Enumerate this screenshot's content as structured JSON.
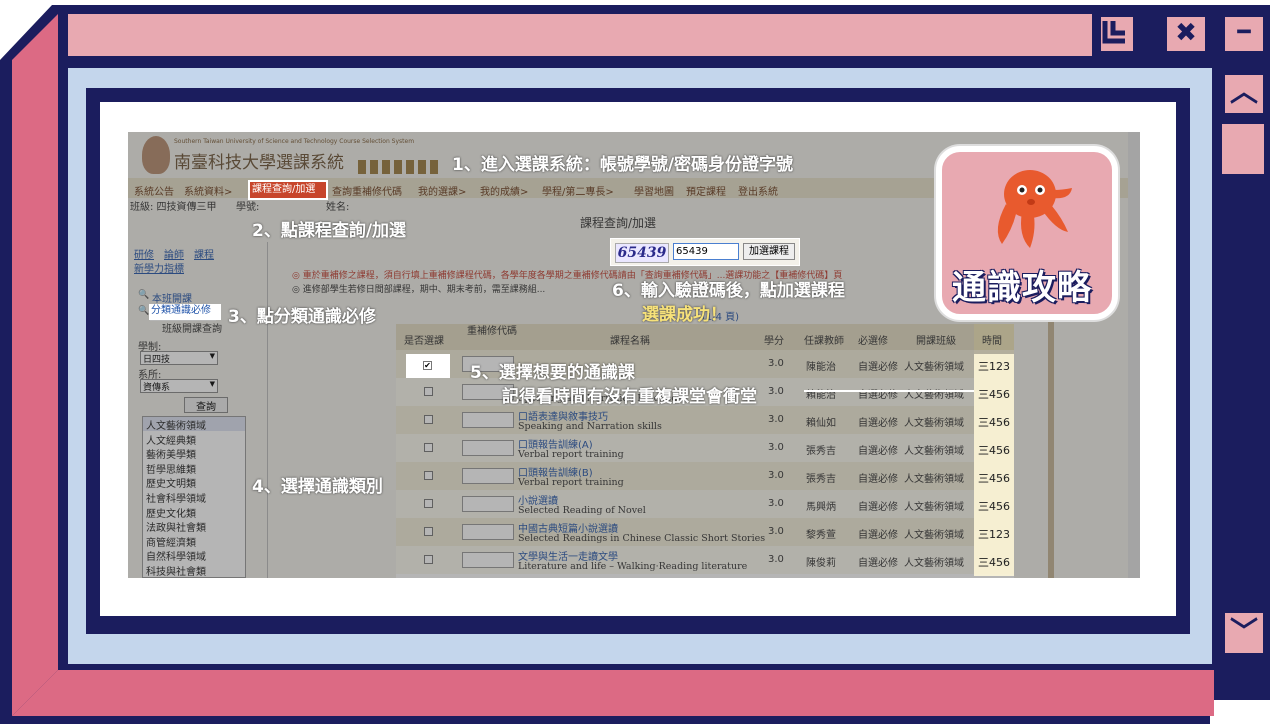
{
  "frame": {
    "colors": {
      "navy": "#1b1d5e",
      "pink": "#e8a9b1",
      "deep_pink": "#dc6a84",
      "light_blue": "#c4d6ec"
    },
    "window_buttons": [
      {
        "name": "restore-icon"
      },
      {
        "name": "close-icon",
        "glyph": "✖"
      },
      {
        "name": "minimize-icon",
        "glyph": "━"
      }
    ],
    "scroll": {
      "up_glyph": "︿",
      "down_glyph": "﹀"
    }
  },
  "badge": {
    "label": "通識攻略",
    "mascot": "octopus-icon",
    "color": "#e8a9b1"
  },
  "system": {
    "subtitle_en": "Southern Taiwan University of Science and Technology Course Selection System",
    "title": "南臺科技大學選課系統",
    "nav": [
      "系統公告",
      "系統資料>",
      "課程查詢/加選",
      "查詢重補修代碼",
      "我的選課>",
      "我的成績>",
      "學程/第二專長>",
      "學習地圖",
      "預定課程",
      "登出系統"
    ],
    "class_info": "班級: 四技資傳三甲",
    "student_no_label": "學號:",
    "name_label": "姓名:",
    "page_heading": "課程查詢/加選",
    "captcha_image_text": "65439",
    "captcha_value": "65439",
    "add_button": "加選課程",
    "left_tabs": [
      "研修",
      "論師",
      "課程",
      "新學力指標"
    ],
    "left_links": [
      "本班開課",
      "分類通識必修",
      "班級開課查詢"
    ],
    "filters": {
      "system_label": "學制:",
      "system_value": "日四技",
      "dept_label": "系所:",
      "dept_value": "資傳系",
      "query_button": "查詢"
    },
    "categories": [
      "人文藝術領域",
      "人文經典類",
      "藝術美學類",
      "哲學思維類",
      "歷史文明類",
      "社會科學領域",
      "歷史文化類",
      "法政與社會類",
      "商管經濟類",
      "自然科學領域",
      "科技與社會類"
    ],
    "notice1": "◎ 重於重補修之課程，須自行填上重補修課程代碼，各學年度各學期之重補修代碼請由「查詢重補修代碼」...選課功能之【重補修代碼】頁",
    "notice2": "◎ 進修部學生若修日間部課程，期中、期末考前，需至課務組...",
    "page_info": "(1/4 頁)",
    "table": {
      "headers": [
        "是否選課",
        "重補修代碼",
        "課程名稱",
        "學分",
        "任課教師",
        "必選修",
        "開課班級",
        "時間"
      ],
      "rows": [
        {
          "checked": true,
          "name": "",
          "name_en": "",
          "credit": "3.0",
          "teacher": "陳能治",
          "req": "自選必修",
          "cls": "人文藝術領域",
          "time": "三123"
        },
        {
          "checked": false,
          "name": "",
          "name_en": "Speaking and Narration Practices",
          "credit": "3.0",
          "teacher": "賴能治",
          "req": "自選必修",
          "cls": "人文藝術領域",
          "time": "三456"
        },
        {
          "checked": false,
          "name": "口語表達與敘事技巧",
          "name_en": "Speaking and Narration skills",
          "credit": "3.0",
          "teacher": "賴仙如",
          "req": "自選必修",
          "cls": "人文藝術領域",
          "time": "三456"
        },
        {
          "checked": false,
          "name": "口頭報告訓練(A)",
          "name_en": "Verbal report training",
          "credit": "3.0",
          "teacher": "張秀吉",
          "req": "自選必修",
          "cls": "人文藝術領域",
          "time": "三456"
        },
        {
          "checked": false,
          "name": "口頭報告訓練(B)",
          "name_en": "Verbal report training",
          "credit": "3.0",
          "teacher": "張秀吉",
          "req": "自選必修",
          "cls": "人文藝術領域",
          "time": "三456"
        },
        {
          "checked": false,
          "name": "小說選讀",
          "name_en": "Selected Reading of Novel",
          "credit": "3.0",
          "teacher": "馬興炳",
          "req": "自選必修",
          "cls": "人文藝術領域",
          "time": "三456"
        },
        {
          "checked": false,
          "name": "中國古典短篇小說選讀",
          "name_en": "Selected Readings in Chinese Classic Short Stories",
          "credit": "3.0",
          "teacher": "黎秀萱",
          "req": "自選必修",
          "cls": "人文藝術領域",
          "time": "三123"
        },
        {
          "checked": false,
          "name": "文學與生活一走讀文學",
          "name_en": "Literature and life – Walking·Reading literature",
          "credit": "3.0",
          "teacher": "陳俊莉",
          "req": "自選必修",
          "cls": "人文藝術領域",
          "time": "三456"
        }
      ]
    }
  },
  "annotations": {
    "step1": "1、進入選課系統：帳號學號/密碼身份證字號",
    "step2": "2、點課程查詢/加選",
    "step3": "3、點分類通識必修",
    "step4": "4、選擇通識類別",
    "step5a": "5、選擇想要的通識課",
    "step5b": "記得看時間有沒有重複課堂會衝堂",
    "step6": "6、輸入驗證碼後，點加選課程",
    "success": "選課成功！"
  }
}
